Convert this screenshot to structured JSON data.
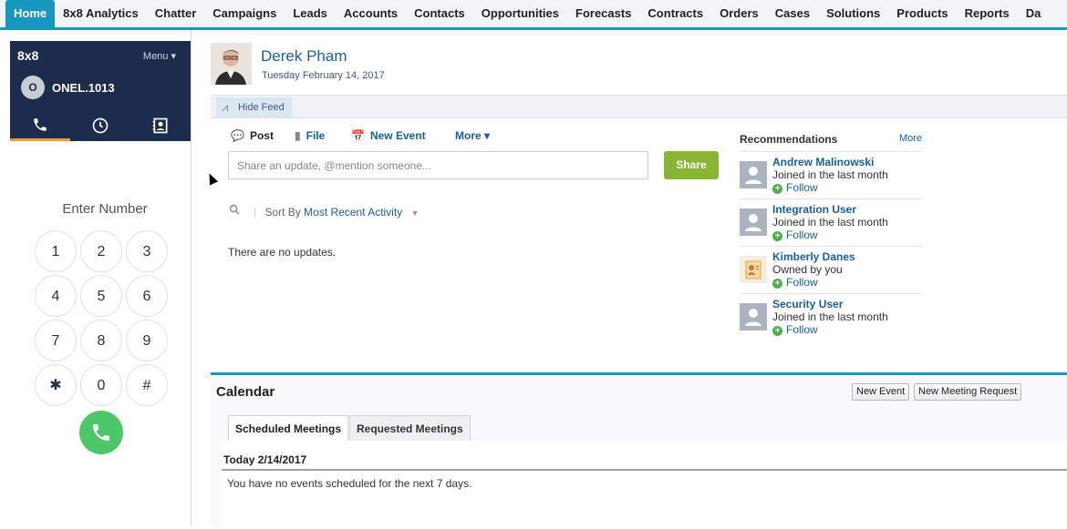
{
  "nav": {
    "tabs": [
      {
        "label": "Home",
        "active": true
      },
      {
        "label": "8x8 Analytics"
      },
      {
        "label": "Chatter"
      },
      {
        "label": "Campaigns"
      },
      {
        "label": "Leads"
      },
      {
        "label": "Accounts"
      },
      {
        "label": "Contacts"
      },
      {
        "label": "Opportunities"
      },
      {
        "label": "Forecasts"
      },
      {
        "label": "Contracts"
      },
      {
        "label": "Orders"
      },
      {
        "label": "Cases"
      },
      {
        "label": "Solutions"
      },
      {
        "label": "Products"
      },
      {
        "label": "Reports"
      },
      {
        "label": "Da"
      }
    ]
  },
  "phone": {
    "brand": "8x8",
    "menu_label": "Menu ▾",
    "avatar_letter": "O",
    "extension": "ONEL.1013",
    "tab_icons": [
      "phone-icon",
      "clock-icon",
      "contacts-icon"
    ],
    "enter_label": "Enter Number",
    "keys": [
      "1",
      "2",
      "3",
      "4",
      "5",
      "6",
      "7",
      "8",
      "9",
      "✱",
      "0",
      "#"
    ],
    "accent": "#1d2b4c",
    "call_color": "#4cc76a"
  },
  "profile": {
    "name": "Derek Pham",
    "date": "Tuesday February 14, 2017",
    "hide_feed": "Hide Feed"
  },
  "publisher": {
    "post": "Post",
    "file": "File",
    "new_event": "New Event",
    "more": "More ▾",
    "placeholder": "Share an update, @mention someone...",
    "share": "Share",
    "sort_by": "Sort By",
    "sort_value": "Most Recent Activity",
    "no_updates": "There are no updates."
  },
  "recommendations": {
    "title": "Recommendations",
    "more": "More",
    "follow": "Follow",
    "items": [
      {
        "name": "Andrew Malinowski",
        "sub": "Joined in the last month"
      },
      {
        "name": "Integration User",
        "sub": "Joined in the last month"
      },
      {
        "name": "Kimberly Danes",
        "sub": "Owned by you"
      },
      {
        "name": "Security User",
        "sub": "Joined in the last month"
      }
    ]
  },
  "calendar": {
    "title": "Calendar",
    "new_event": "New Event",
    "new_meeting": "New Meeting Request",
    "tab_scheduled": "Scheduled Meetings",
    "tab_requested": "Requested Meetings",
    "today": "Today 2/14/2017",
    "no_events": "You have no events scheduled for the next 7 days."
  },
  "colors": {
    "brand": "#1797c0",
    "link": "#1a5e9c",
    "share": "#8ab434"
  }
}
